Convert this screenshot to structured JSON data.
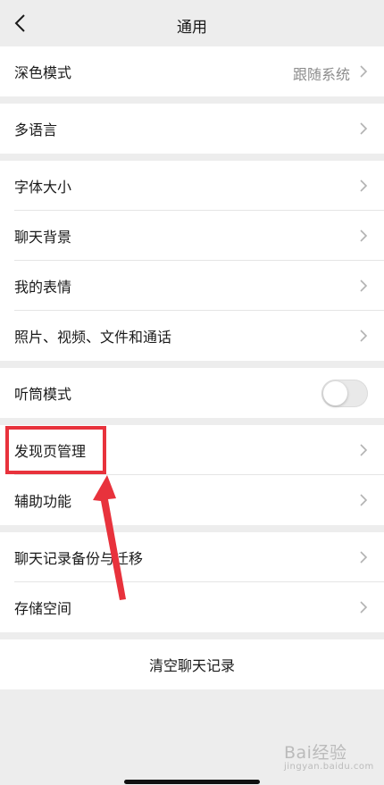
{
  "header": {
    "title": "通用",
    "back_icon": "chevron-left-icon"
  },
  "groups": {
    "dark_mode": {
      "label": "深色模式",
      "value": "跟随系统"
    },
    "language": {
      "label": "多语言"
    },
    "display": {
      "font_size": "字体大小",
      "chat_background": "聊天背景",
      "my_stickers": "我的表情",
      "media_files": "照片、视频、文件和通话"
    },
    "earpiece": {
      "label": "听筒模式",
      "enabled": false
    },
    "discover": {
      "discover_manage": "发现页管理",
      "accessibility": "辅助功能"
    },
    "storage": {
      "backup_migrate": "聊天记录备份与迁移",
      "storage_space": "存储空间"
    },
    "clear": {
      "label": "清空聊天记录"
    }
  },
  "annotation": {
    "color": "#e8323c"
  },
  "watermark": {
    "text": "Bai经验",
    "sub": "jingyan.baidu.com"
  }
}
